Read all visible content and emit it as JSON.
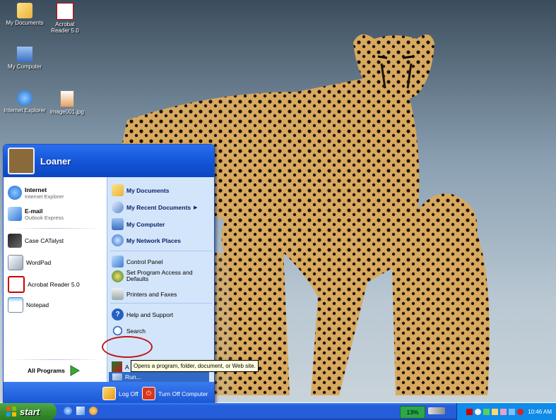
{
  "desktop": {
    "icons": [
      {
        "label": "My Documents",
        "icon": "folder-icon"
      },
      {
        "label": "Acrobat Reader 5.0",
        "icon": "acrobat-icon"
      },
      {
        "label": "My Computer",
        "icon": "computer-icon"
      },
      {
        "label": "Internet Explorer",
        "icon": "ie-icon"
      },
      {
        "label": "image001.jpg",
        "icon": "image-file-icon"
      }
    ]
  },
  "start_menu": {
    "user_name": "Loaner",
    "pinned": [
      {
        "title": "Internet",
        "subtitle": "Internet Explorer"
      },
      {
        "title": "E-mail",
        "subtitle": "Outlook Express"
      }
    ],
    "recent": [
      "Case CATalyst",
      "WordPad",
      "Acrobat Reader 5.0",
      "Notepad"
    ],
    "all_programs": "All Programs",
    "right": {
      "my_documents": "My Documents",
      "my_recent_documents": "My Recent Documents",
      "my_computer": "My Computer",
      "my_network_places": "My Network Places",
      "control_panel": "Control Panel",
      "set_program_access": "Set Program Access and Defaults",
      "printers_and_faxes": "Printers and Faxes",
      "help_and_support": "Help and Support",
      "search": "Search",
      "run": "Run..."
    },
    "log_off": "Log Off",
    "turn_off": "Turn Off Computer"
  },
  "tooltip": "Opens a program, folder, document, or Web site.",
  "partial_item_letter": "A",
  "taskbar": {
    "start": "start",
    "battery": "13%",
    "clock": "10:46 AM"
  }
}
